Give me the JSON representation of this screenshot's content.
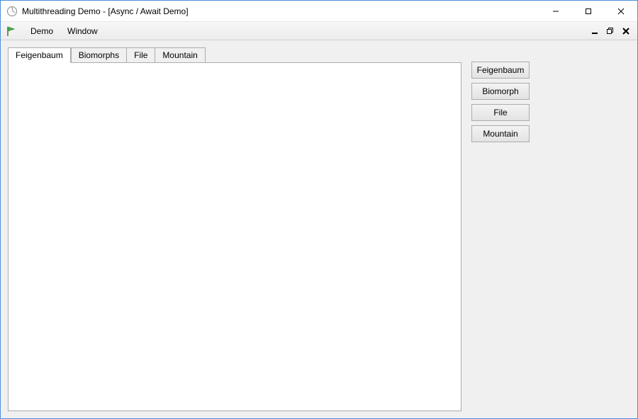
{
  "title": "Multithreading Demo - [Async / Await Demo]",
  "menu": {
    "items": [
      "Demo",
      "Window"
    ]
  },
  "tabs": [
    {
      "label": "Feigenbaum",
      "active": true
    },
    {
      "label": "Biomorphs",
      "active": false
    },
    {
      "label": "File",
      "active": false
    },
    {
      "label": "Mountain",
      "active": false
    }
  ],
  "buttons": [
    "Feigenbaum",
    "Biomorph",
    "File",
    "Mountain"
  ]
}
